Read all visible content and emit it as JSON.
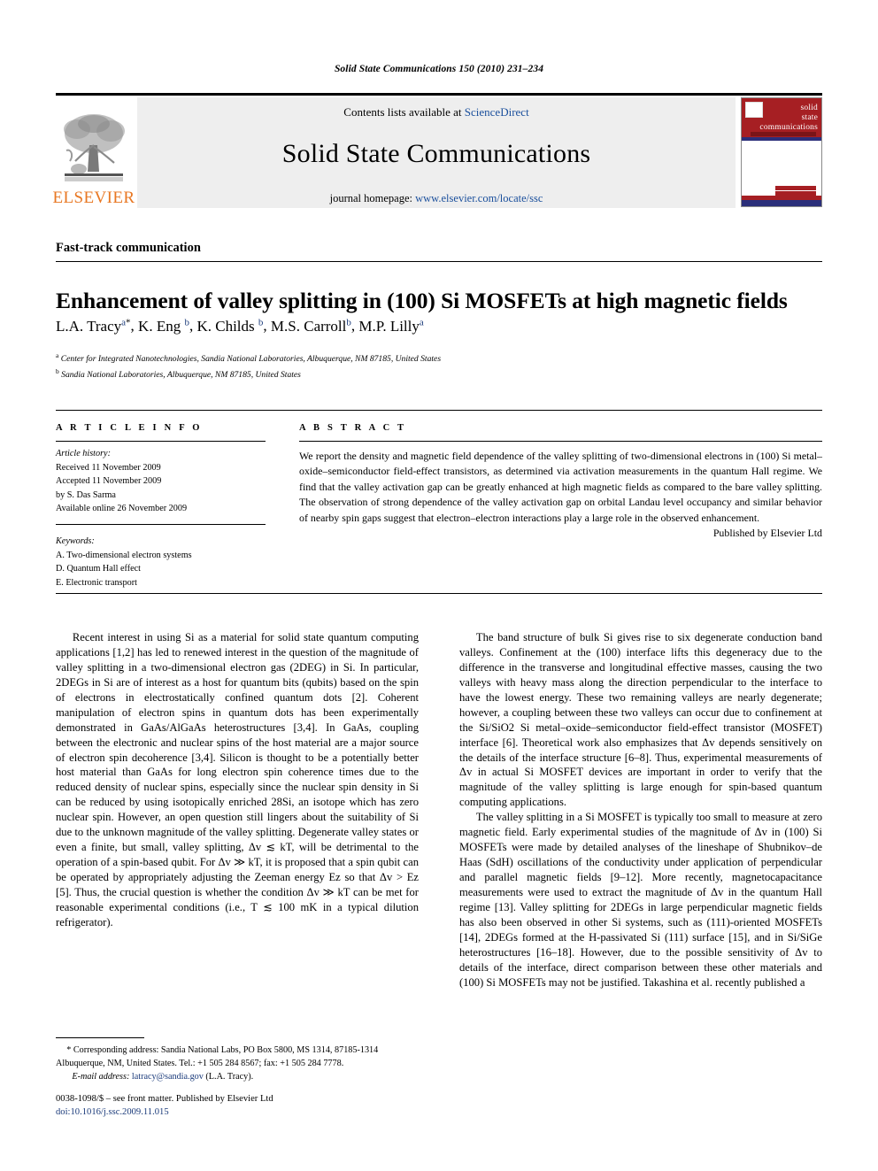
{
  "running_head": "Solid State Communications 150 (2010) 231–234",
  "masthead": {
    "contents_prefix": "Contents lists available at ",
    "contents_link": "ScienceDirect",
    "journal_title": "Solid State Communications",
    "homepage_prefix": "journal homepage: ",
    "homepage_url": "www.elsevier.com/locate/ssc",
    "publisher_logo_text": "ELSEVIER",
    "cover": {
      "line1": "solid",
      "line2": "state",
      "line3": "communications"
    }
  },
  "article": {
    "section_label": "Fast-track communication",
    "title": "Enhancement of valley splitting in (100) Si MOSFETs at high magnetic fields",
    "authors": [
      {
        "name": "L.A. Tracy",
        "sup": "a",
        "star": "*"
      },
      {
        "name": "K. Eng",
        "sup": "b",
        "star": ""
      },
      {
        "name": "K. Childs",
        "sup": "b",
        "star": ""
      },
      {
        "name": "M.S. Carroll",
        "sup": "b",
        "star": ""
      },
      {
        "name": "M.P. Lilly",
        "sup": "a",
        "star": ""
      }
    ],
    "affiliations": [
      {
        "mark": "a",
        "text": "Center for Integrated Nanotechnologies, Sandia National Laboratories, Albuquerque, NM 87185, United States"
      },
      {
        "mark": "b",
        "text": "Sandia National Laboratories, Albuquerque, NM 87185, United States"
      }
    ]
  },
  "article_info": {
    "heading": "A R T I C L E    I N F O",
    "history_label": "Article history:",
    "history": [
      "Received 11 November 2009",
      "Accepted 11 November 2009",
      "by S. Das Sarma",
      "Available online 26 November 2009"
    ],
    "keywords_label": "Keywords:",
    "keywords": [
      "A. Two-dimensional electron systems",
      "D. Quantum Hall effect",
      "E. Electronic transport"
    ]
  },
  "abstract": {
    "heading": "A B S T R A C T",
    "text": "We report the density and magnetic field dependence of the valley splitting of two-dimensional electrons in (100) Si metal–oxide–semiconductor field-effect transistors, as determined via activation measurements in the quantum Hall regime. We find that the valley activation gap can be greatly enhanced at high magnetic fields as compared to the bare valley splitting. The observation of strong dependence of the valley activation gap on orbital Landau level occupancy and similar behavior of nearby spin gaps suggest that electron–electron interactions play a large role in the observed enhancement.",
    "publisher": "Published by Elsevier Ltd"
  },
  "body": {
    "left_column": [
      "Recent interest in using Si as a material for solid state quantum computing applications [1,2] has led to renewed interest in the question of the magnitude of valley splitting in a two-dimensional electron gas (2DEG) in Si. In particular, 2DEGs in Si are of interest as a host for quantum bits (qubits) based on the spin of electrons in electrostatically confined quantum dots [2]. Coherent manipulation of electron spins in quantum dots has been experimentally demonstrated in GaAs/AlGaAs heterostructures [3,4]. In GaAs, coupling between the electronic and nuclear spins of the host material are a major source of electron spin decoherence [3,4]. Silicon is thought to be a potentially better host material than GaAs for long electron spin coherence times due to the reduced density of nuclear spins, especially since the nuclear spin density in Si can be reduced by using isotopically enriched 28Si, an isotope which has zero nuclear spin. However, an open question still lingers about the suitability of Si due to the unknown magnitude of the valley splitting. Degenerate valley states or even a finite, but small, valley splitting, Δv ≲ kT, will be detrimental to the operation of a spin-based qubit. For Δv ≫ kT, it is proposed that a spin qubit can be operated by appropriately adjusting the Zeeman energy Ez so that Δv > Ez [5]. Thus, the crucial question is whether the condition Δv ≫ kT can be met for reasonable experimental conditions (i.e., T ≲ 100 mK in a typical dilution refrigerator)."
    ],
    "right_column": [
      "The band structure of bulk Si gives rise to six degenerate conduction band valleys. Confinement at the (100) interface lifts this degeneracy due to the difference in the transverse and longitudinal effective masses, causing the two valleys with heavy mass along the direction perpendicular to the interface to have the lowest energy. These two remaining valleys are nearly degenerate; however, a coupling between these two valleys can occur due to confinement at the Si/SiO2 Si metal–oxide–semiconductor field-effect transistor (MOSFET) interface [6]. Theoretical work also emphasizes that Δv depends sensitively on the details of the interface structure [6–8]. Thus, experimental measurements of Δv in actual Si MOSFET devices are important in order to verify that the magnitude of the valley splitting is large enough for spin-based quantum computing applications.",
      "The valley splitting in a Si MOSFET is typically too small to measure at zero magnetic field. Early experimental studies of the magnitude of Δv in (100) Si MOSFETs were made by detailed analyses of the lineshape of Shubnikov–de Haas (SdH) oscillations of the conductivity under application of perpendicular and parallel magnetic fields [9–12]. More recently, magnetocapacitance measurements were used to extract the magnitude of Δv in the quantum Hall regime [13]. Valley splitting for 2DEGs in large perpendicular magnetic fields has also been observed in other Si systems, such as (111)-oriented MOSFETs [14], 2DEGs formed at the H-passivated Si (111) surface [15], and in Si/SiGe heterostructures [16–18]. However, due to the possible sensitivity of Δv to details of the interface, direct comparison between these other materials and (100) Si MOSFETs may not be justified. Takashina et al. recently published a"
    ]
  },
  "footnote": {
    "corresponding": "* Corresponding address: Sandia National Labs, PO Box 5800, MS 1314, 87185-1314 Albuquerque, NM, United States. Tel.: +1 505 284 8567; fax: +1 505 284 7778.",
    "email_label": "E-mail address:",
    "email": "latracy@sandia.gov",
    "email_owner": "(L.A. Tracy)."
  },
  "colophon": {
    "issn_line": "0038-1098/$ – see front matter. Published by Elsevier Ltd",
    "doi_line": "doi:10.1016/j.ssc.2009.11.015"
  }
}
